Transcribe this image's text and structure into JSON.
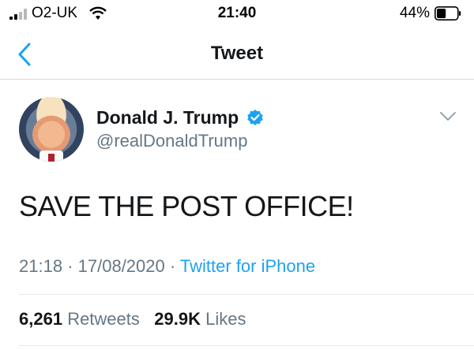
{
  "status_bar": {
    "carrier": "O2-UK",
    "time": "21:40",
    "battery_percent": "44%",
    "battery_level": 0.44,
    "signal_bars": 2
  },
  "nav": {
    "title": "Tweet",
    "back_icon": "chevron-left-icon"
  },
  "tweet": {
    "author_name": "Donald J. Trump",
    "handle": "@realDonaldTrump",
    "verified_icon": "verified-badge-icon",
    "text": "SAVE THE POST OFFICE!",
    "time": "21:18",
    "separator": "·",
    "date": "17/08/2020",
    "source": "Twitter for iPhone",
    "retweets_count": "6,261",
    "retweets_label": "Retweets",
    "likes_count": "29.9K",
    "likes_label": "Likes"
  },
  "colors": {
    "accent": "#1da1f2",
    "secondary_text": "#657786",
    "primary_text": "#14171a"
  }
}
